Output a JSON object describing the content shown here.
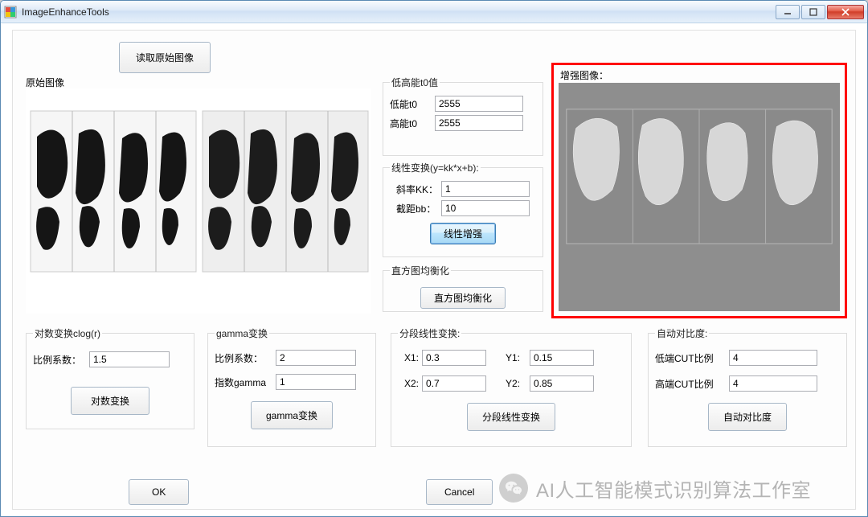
{
  "window": {
    "title": "ImageEnhanceTools"
  },
  "buttons": {
    "loadOriginal": "读取原始图像",
    "linearEnhance": "线性增强",
    "histEq": "直方图均衡化",
    "logTransform": "对数变换",
    "gammaTransform": "gamma变换",
    "piecewise": "分段线性变换",
    "autoContrast": "自动对比度",
    "ok": "OK",
    "cancel": "Cancel"
  },
  "labels": {
    "originalImage": "原始图像",
    "enhancedImage": "增强图像：",
    "t0group": "低高能t0值",
    "lowt0": "低能t0",
    "hight0": "高能t0",
    "linearGroup": "线性变换(y=kk*x+b):",
    "slopeKK": "斜率KK：",
    "interceptBB": "截距bb：",
    "histGroup": "直方图均衡化",
    "logGroup": "对数变换clog(r)",
    "logCoef": "比例系数：",
    "gammaGroup": "gamma变换",
    "gammaCoef": "比例系数：",
    "gammaExp": "指数gamma",
    "piecewiseGroup": "分段线性变换:",
    "x1": "X1:",
    "y1": "Y1:",
    "x2": "X2:",
    "y2": "Y2:",
    "autoGroup": "自动对比度:",
    "lowCut": "低端CUT比例",
    "highCut": "高端CUT比例"
  },
  "values": {
    "lowt0": "2555",
    "hight0": "2555",
    "slopeKK": "1",
    "interceptBB": "10",
    "logCoef": "1.5",
    "gammaCoef": "2",
    "gammaExp": "1",
    "x1": "0.3",
    "y1": "0.15",
    "x2": "0.7",
    "y2": "0.85",
    "lowCut": "4",
    "highCut": "4"
  },
  "watermark": "AI人工智能模式识别算法工作室"
}
